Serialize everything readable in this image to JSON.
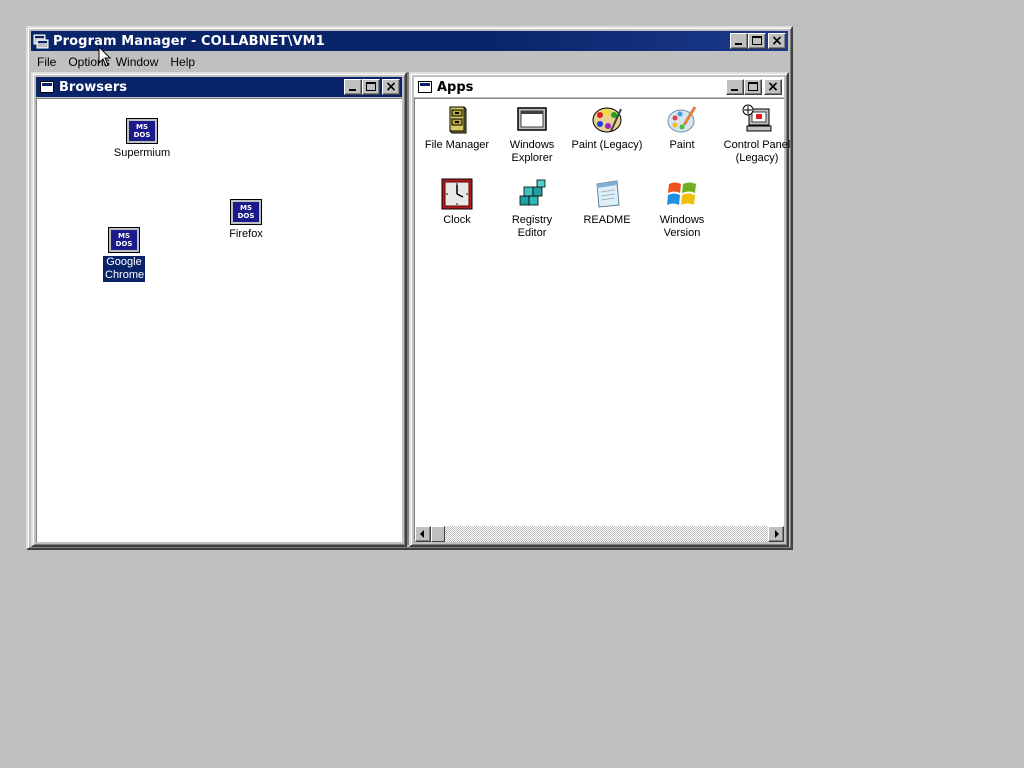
{
  "program_manager": {
    "title": "Program Manager - COLLABNET\\VM1",
    "menu": [
      "File",
      "Options",
      "Window",
      "Help"
    ]
  },
  "browsers_window": {
    "title": "Browsers",
    "icons": [
      {
        "label": "Supermium",
        "icon": "msdos-icon",
        "icon_text": "MS DOS"
      },
      {
        "label": "Firefox",
        "icon": "msdos-icon",
        "icon_text": "MS DOS"
      },
      {
        "label": "Google Chrome",
        "icon": "msdos-icon",
        "icon_text": "MS DOS",
        "selected": true
      }
    ]
  },
  "apps_window": {
    "title": "Apps",
    "icons": [
      {
        "label": "File Manager",
        "icon": "file-cabinet-icon"
      },
      {
        "label": "Windows Explorer",
        "icon": "explorer-window-icon"
      },
      {
        "label": "Paint (Legacy)",
        "icon": "paint-palette-icon"
      },
      {
        "label": "Paint",
        "icon": "paint-brush-icon"
      },
      {
        "label": "Control Panel (Legacy)",
        "icon": "control-panel-icon"
      },
      {
        "label": "Clock",
        "icon": "clock-icon"
      },
      {
        "label": "Registry Editor",
        "icon": "registry-cubes-icon"
      },
      {
        "label": "README",
        "icon": "notepad-icon"
      },
      {
        "label": "Windows Version",
        "icon": "windows-logo-icon"
      }
    ]
  },
  "colors": {
    "desktop": "#c0c0c0",
    "active_title": "#0a246a",
    "selection": "#0a246a"
  }
}
